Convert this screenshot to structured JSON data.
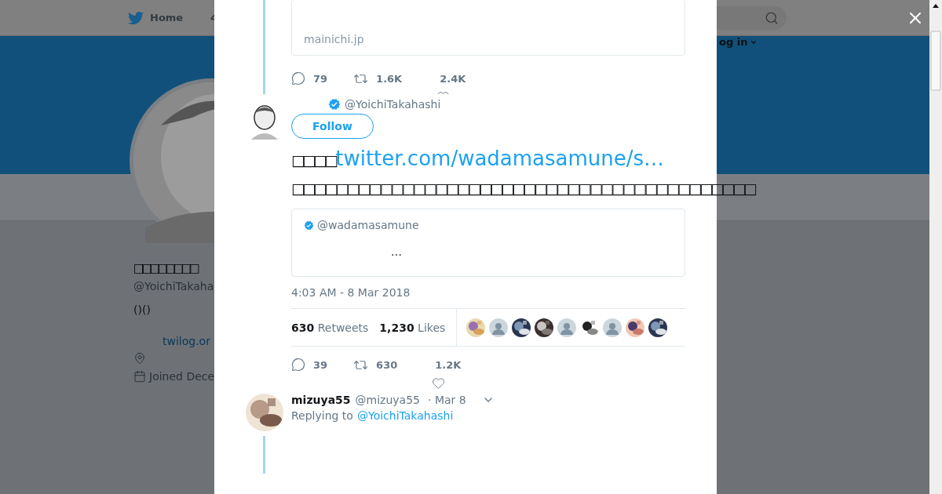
{
  "background_page": {
    "nav": {
      "home": "Home"
    },
    "login": "og in",
    "profile": {
      "name": "□□□□□□□□",
      "handle": "@YoichiTakaha",
      "bio": "()()",
      "link": "twilog.or",
      "joined": "Joined Dece"
    }
  },
  "modal": {
    "previous_tweet": {
      "card_domain": "mainichi.jp",
      "actions": {
        "replies": "79",
        "retweets": "1.6K",
        "likes": "2.4K"
      }
    },
    "tweet": {
      "handle": "@YoichiTakahashi",
      "verified": true,
      "follow": "Follow",
      "text_prefix": "□□□□",
      "link": "twitter.com/wadamasamune/s…",
      "text_line2": "□□□□□□□□□□□□□□□□□□□□□□□□□□□□□□□□□□□□□□□□□□",
      "quote": {
        "handle": "@wadamasamune",
        "verified": true,
        "text": "…"
      },
      "timestamp": "4:03 AM - 8 Mar 2018",
      "retweets_count": "630",
      "retweets_label": "Retweets",
      "likes_count": "1,230",
      "likes_label": "Likes",
      "likers": [
        {
          "kind": "picture"
        },
        {
          "kind": "default"
        },
        {
          "kind": "picture"
        },
        {
          "kind": "picture"
        },
        {
          "kind": "default"
        },
        {
          "kind": "picture"
        },
        {
          "kind": "default"
        },
        {
          "kind": "picture"
        },
        {
          "kind": "picture"
        }
      ],
      "actions": {
        "replies": "39",
        "retweets": "630",
        "likes": "1.2K"
      }
    },
    "reply": {
      "name": "mizuya55",
      "handle": "@mizuya55",
      "date": "· Mar 8",
      "replying_label": "Replying to",
      "replying_to": "@YoichiTakahashi"
    }
  }
}
